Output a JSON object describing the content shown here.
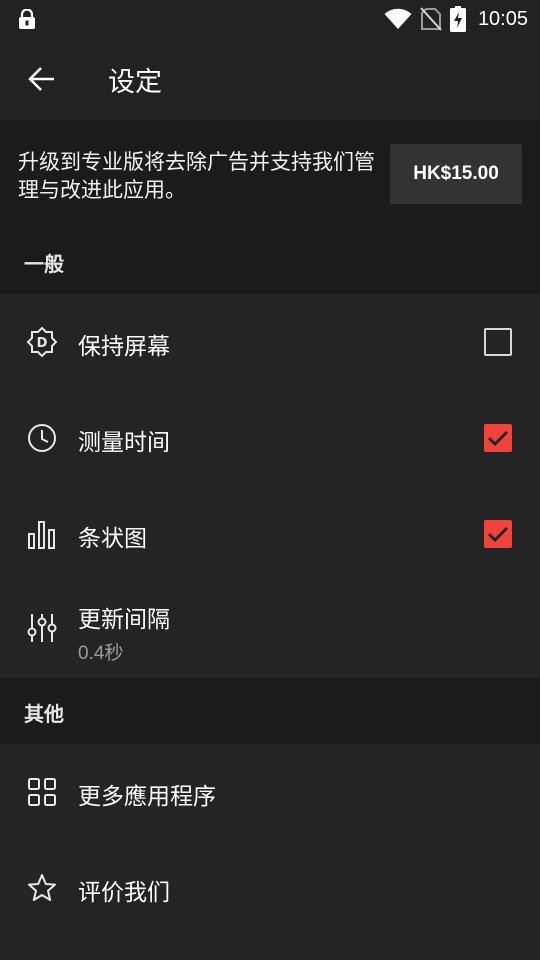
{
  "status_bar": {
    "time": "10:05",
    "icons": [
      "lock-icon",
      "wifi-icon",
      "no-sim-icon",
      "battery-charging-icon"
    ]
  },
  "app_bar": {
    "title": "设定",
    "back_icon": "arrow-back-icon"
  },
  "promo": {
    "text": "升级到专业版将去除广告并支持我们管理与改进此应用。",
    "price_button": "HK$15.00"
  },
  "sections": {
    "general": {
      "header": "一般",
      "items": [
        {
          "label": "保持屏幕",
          "icon": "screen-brightness-icon",
          "checked": false
        },
        {
          "label": "测量时间",
          "icon": "clock-icon",
          "checked": true
        },
        {
          "label": "条状图",
          "icon": "bar-chart-icon",
          "checked": true
        },
        {
          "label": "更新间隔",
          "sub": "0.4秒",
          "icon": "tune-sliders-icon"
        }
      ]
    },
    "other": {
      "header": "其他",
      "items": [
        {
          "label": "更多應用程序",
          "icon": "grid-apps-icon"
        },
        {
          "label": "评价我们",
          "icon": "star-outline-icon"
        }
      ]
    }
  },
  "colors": {
    "background": "#242424",
    "header_background": "#1b1b1b",
    "accent": "#f0443b"
  }
}
